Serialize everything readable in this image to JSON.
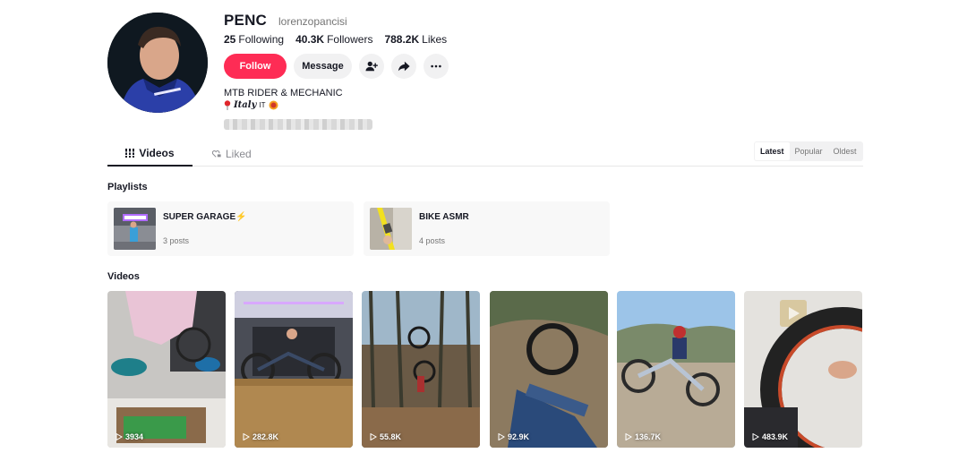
{
  "profile": {
    "name": "PENC",
    "username": "lorenzopancisi",
    "bio_line1": "MTB RIDER & MECHANIC",
    "bio_location": "𝑰𝒕𝒂𝒍𝒚",
    "bio_flag": "IT"
  },
  "stats": {
    "following_count": "25",
    "following_label": "Following",
    "followers_count": "40.3K",
    "followers_label": "Followers",
    "likes_count": "788.2K",
    "likes_label": "Likes"
  },
  "actions": {
    "follow_label": "Follow",
    "message_label": "Message",
    "add_friend_icon": "add-friend-icon",
    "share_icon": "share-icon",
    "more_icon": "more-icon"
  },
  "tabs": [
    {
      "label": "Videos",
      "icon": "grid-icon",
      "active": true
    },
    {
      "label": "Liked",
      "icon": "heart-lock-icon",
      "active": false
    }
  ],
  "sort_options": [
    "Latest",
    "Popular",
    "Oldest"
  ],
  "sort_selected": "Latest",
  "playlists_title": "Playlists",
  "playlists": [
    {
      "title": "SUPER GARAGE⚡",
      "count": "3 posts"
    },
    {
      "title": "BIKE ASMR",
      "count": "4 posts"
    }
  ],
  "videos_title": "Videos",
  "videos": [
    {
      "views": "3934"
    },
    {
      "views": "282.8K"
    },
    {
      "views": "55.8K"
    },
    {
      "views": "92.9K"
    },
    {
      "views": "136.7K"
    },
    {
      "views": "483.9K"
    }
  ],
  "colors": {
    "accent": "#fe2c55",
    "text": "#161823",
    "muted": "#757575"
  }
}
